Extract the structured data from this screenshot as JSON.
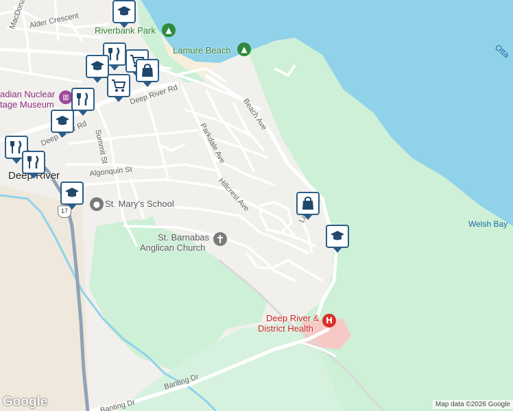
{
  "map": {
    "colors": {
      "water": "#8fd2ea",
      "park": "#cdf0d7",
      "land": "#f2f0ec",
      "road": "#ffffff",
      "highway": "#8fa3b6",
      "river": "#8fd2ea",
      "hospital": "#f7c9c4",
      "pin_border": "#2a5d87"
    },
    "water_labels": {
      "bay": "Welsh Bay",
      "river_partial": "Otta"
    },
    "town": "Deep River",
    "highway_shield": "17",
    "streets": {
      "macdonald": "MacDonald St",
      "alder": "Alder Crescent",
      "deep_river_rd_1": "Deep River Rd",
      "deep_river_rd_2": "Deep River Rd",
      "summit": "Summit St",
      "algonquin": "Algonquin St",
      "parkdale": "Parkdale Ave",
      "beach": "Beach Ave",
      "hillcrest": "Hillcrest Ave",
      "banting_1": "Banting Dr",
      "banting_2": "Banting Dr",
      "partial_l": "La"
    },
    "pois": {
      "riverbank_park": "Riverbank Park",
      "lamure_beach": "Lamure Beach",
      "museum_1": "adian Nuclear",
      "museum_2": "tage Museum",
      "st_marys": "St. Mary's School",
      "st_barnabas_1": "St. Barnabas",
      "st_barnabas_2": "Anglican Church",
      "hospital_1": "Deep River &",
      "hospital_2": "District Health"
    },
    "markers": [
      {
        "name": "school-marker",
        "icon": "graduation-cap-icon"
      },
      {
        "name": "restaurant-marker",
        "icon": "fork-knife-icon"
      },
      {
        "name": "grocery-marker",
        "icon": "shopping-cart-icon"
      },
      {
        "name": "school-marker",
        "icon": "graduation-cap-icon"
      },
      {
        "name": "shopping-marker",
        "icon": "shopping-bag-icon"
      },
      {
        "name": "grocery-marker",
        "icon": "shopping-cart-icon"
      },
      {
        "name": "restaurant-marker",
        "icon": "fork-knife-icon"
      },
      {
        "name": "school-marker",
        "icon": "graduation-cap-icon"
      },
      {
        "name": "restaurant-marker",
        "icon": "fork-knife-icon"
      },
      {
        "name": "restaurant-marker",
        "icon": "fork-knife-icon"
      },
      {
        "name": "school-marker",
        "icon": "graduation-cap-icon"
      },
      {
        "name": "shopping-marker",
        "icon": "shopping-bag-icon"
      },
      {
        "name": "school-marker",
        "icon": "graduation-cap-icon"
      }
    ],
    "google_logo": "Google",
    "attribution": "Map data ©2026 Google"
  }
}
